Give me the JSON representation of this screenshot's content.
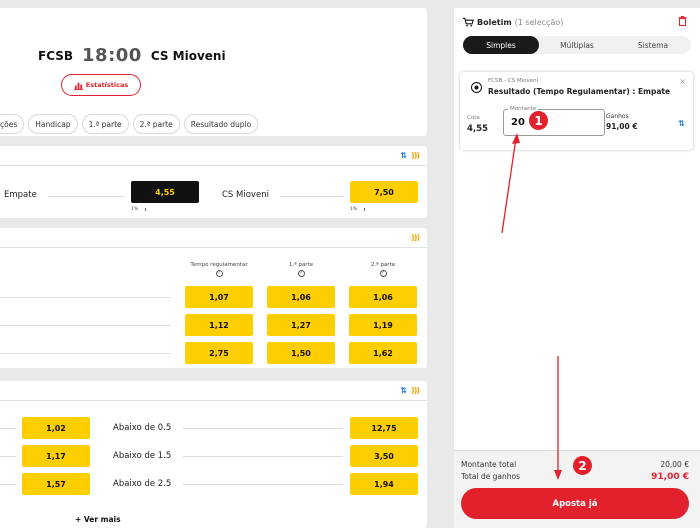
{
  "match": {
    "home": "FCSB",
    "time": "18:00",
    "away": "CS Mioveni",
    "stats_label": "Estatísticas"
  },
  "chips": [
    "ções",
    "Handicap",
    "1.ª parte",
    "2.ª parte",
    "Resultado duplo"
  ],
  "result_market": {
    "draw_label": "Empate",
    "draw_odd": "4,55",
    "draw_pct": "1%",
    "away_label": "CS Mioveni",
    "away_odd": "7,50",
    "away_pct": "1%"
  },
  "double_market": {
    "col_headers": [
      "Tempo regulamentar",
      "1.ª parte",
      "2.ª parte"
    ],
    "help_glyph": "?",
    "rows": [
      [
        "1,07",
        "1,06",
        "1,06"
      ],
      [
        "1,12",
        "1,27",
        "1,19"
      ],
      [
        "2,75",
        "1,50",
        "1,62"
      ]
    ]
  },
  "goals_market": {
    "rows": [
      {
        "over_odd": "1,02",
        "under_label": "Abaixo de 0.5",
        "under_odd": "12,75"
      },
      {
        "over_odd": "1,17",
        "under_label": "Abaixo de 1.5",
        "under_odd": "3,50"
      },
      {
        "over_odd": "1,57",
        "under_label": "Abaixo de 2.5",
        "under_odd": "1,94"
      }
    ],
    "more_label": "+ Ver mais"
  },
  "betslip": {
    "title": "Boletim",
    "subtitle": "(1 selecção)",
    "tabs": [
      "Simples",
      "Múltiplas",
      "Sistema"
    ],
    "selection": {
      "teams": "FCSB - CS Mioveni",
      "market": "Resultado (Tempo Regulamentar) : Empate",
      "close": "×",
      "odd_label": "Cota",
      "odd_value": "4,55",
      "stake_label": "Montante",
      "stake_value": "20",
      "win_label": "Ganhos",
      "win_value": "91,00 €"
    },
    "total_stake_label": "Montante total",
    "total_stake_value": "20,00 €",
    "total_win_label": "Total de ganhos",
    "total_win_value": "91,00 €",
    "cta_label": "Aposta já"
  },
  "annotations": {
    "step1": "1",
    "step2": "2"
  },
  "colors": {
    "accent_red": "#e3212c",
    "odds_yellow": "#ffce00",
    "selected_dark": "#111111",
    "swap_blue": "#1a7bd5"
  },
  "icons": {
    "swap": "swap-icon",
    "hot": "fire-icon",
    "cart": "cart-icon",
    "trash": "trash-icon",
    "ball": "football-icon",
    "stats": "bar-chart-icon"
  }
}
